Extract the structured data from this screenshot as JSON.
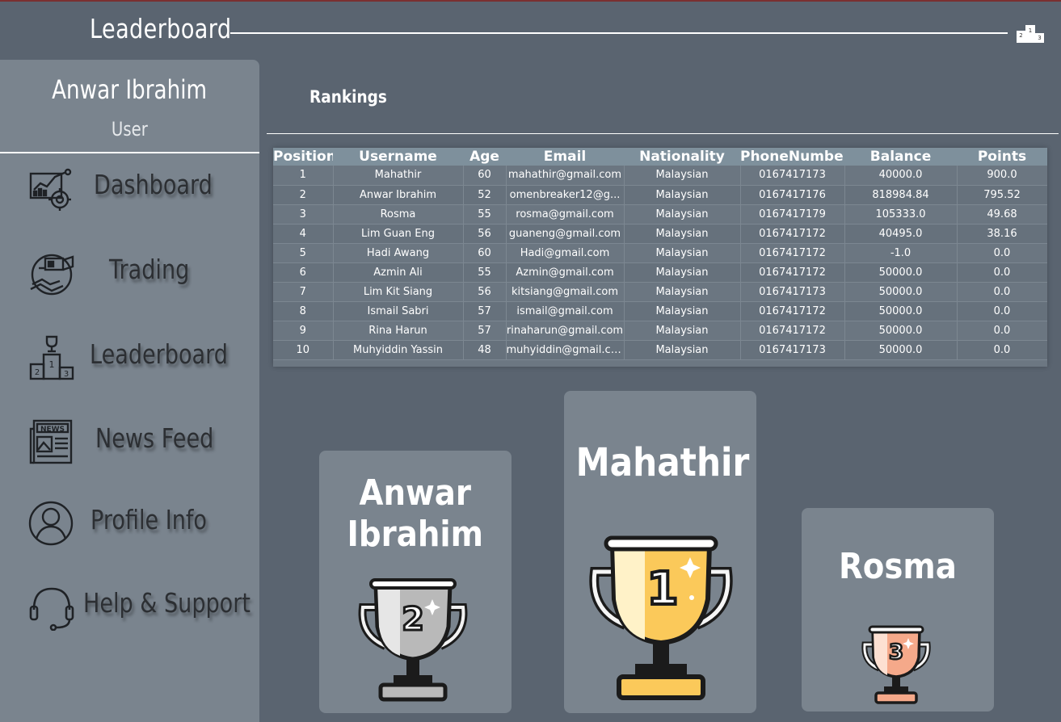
{
  "header": {
    "title": "Leaderboard",
    "icon": "podium-icon"
  },
  "sidebar": {
    "user_name": "Anwar Ibrahim",
    "user_role": "User",
    "items": [
      {
        "label": "Dashboard",
        "icon": "dashboard-icon"
      },
      {
        "label": "Trading",
        "icon": "trading-icon"
      },
      {
        "label": "Leaderboard",
        "icon": "leaderboard-icon"
      },
      {
        "label": "News Feed",
        "icon": "news-icon"
      },
      {
        "label": "Profile Info",
        "icon": "profile-icon"
      },
      {
        "label": "Help & Support",
        "icon": "headset-icon"
      }
    ]
  },
  "main": {
    "rankings_title": "Rankings",
    "table": {
      "columns": [
        "Position",
        "Username",
        "Age",
        "Email",
        "Nationality",
        "PhoneNumber",
        "Balance",
        "Points"
      ],
      "rows": [
        [
          "1",
          "Mahathir",
          "60",
          "mahathir@gmail.com",
          "Malaysian",
          "0167417173",
          "40000.0",
          "900.0"
        ],
        [
          "2",
          "Anwar Ibrahim",
          "52",
          "omenbreaker12@g...",
          "Malaysian",
          "0167417176",
          "818984.84",
          "795.52"
        ],
        [
          "3",
          "Rosma",
          "55",
          "rosma@gmail.com",
          "Malaysian",
          "0167417179",
          "105333.0",
          "49.68"
        ],
        [
          "4",
          "Lim Guan Eng",
          "56",
          "guaneng@gmail.com",
          "Malaysian",
          "0167417172",
          "40495.0",
          "38.16"
        ],
        [
          "5",
          "Hadi Awang",
          "60",
          "Hadi@gmail.com",
          "Malaysian",
          "0167417172",
          "-1.0",
          "0.0"
        ],
        [
          "6",
          "Azmin Ali",
          "55",
          "Azmin@gmail.com",
          "Malaysian",
          "0167417172",
          "50000.0",
          "0.0"
        ],
        [
          "7",
          "Lim Kit Siang",
          "56",
          "kitsiang@gmail.com",
          "Malaysian",
          "0167417173",
          "50000.0",
          "0.0"
        ],
        [
          "8",
          "Ismail Sabri",
          "57",
          "ismail@gmail.com",
          "Malaysian",
          "0167417172",
          "50000.0",
          "0.0"
        ],
        [
          "9",
          "Rina Harun",
          "57",
          "rinaharun@gmail.com",
          "Malaysian",
          "0167417172",
          "50000.0",
          "0.0"
        ],
        [
          "10",
          "Muhyiddin Yassin",
          "48",
          "muhyiddin@gmail.com",
          "Malaysian",
          "0167417173",
          "50000.0",
          "0.0"
        ]
      ]
    },
    "podium": {
      "first": {
        "name": "Mahathir",
        "rank": "1",
        "color": "#fbc95a"
      },
      "second": {
        "name": "Anwar Ibrahim",
        "rank": "2",
        "color": "#b9b9b9"
      },
      "third": {
        "name": "Rosma",
        "rank": "3",
        "color": "#f5a98a"
      }
    }
  },
  "colors": {
    "background": "#5a6470",
    "sidebar": "#7a848e",
    "table_header": "#7e909c",
    "nav_text": "#2c2f33"
  }
}
